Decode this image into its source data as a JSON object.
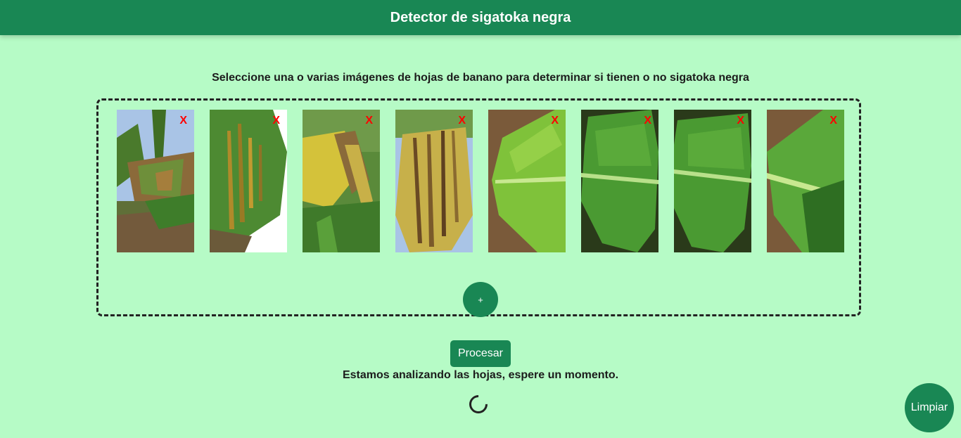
{
  "header": {
    "title": "Detector de sigatoka negra"
  },
  "instructions": "Seleccione una o varias imágenes de hojas de banano para determinar si tienen o no sigatoka negra",
  "images": [
    {
      "remove_label": "X",
      "kind": "diseased-leaf-sky"
    },
    {
      "remove_label": "X",
      "kind": "streaked-leaf"
    },
    {
      "remove_label": "X",
      "kind": "yellow-diseased-leaf"
    },
    {
      "remove_label": "X",
      "kind": "yellow-streaked-leaf"
    },
    {
      "remove_label": "X",
      "kind": "healthy-leaf-soil"
    },
    {
      "remove_label": "X",
      "kind": "healthy-leaf-dark"
    },
    {
      "remove_label": "X",
      "kind": "healthy-leaf-dark"
    },
    {
      "remove_label": "X",
      "kind": "healthy-leaf-soil"
    }
  ],
  "add_button": {
    "label": "+"
  },
  "process_button": {
    "label": "Procesar"
  },
  "status_text": "Estamos analizando las hojas, espere un momento.",
  "clear_button": {
    "label": "Limpiar"
  },
  "colors": {
    "background": "#b6fbc6",
    "primary": "#198754",
    "remove": "#ff0000"
  }
}
